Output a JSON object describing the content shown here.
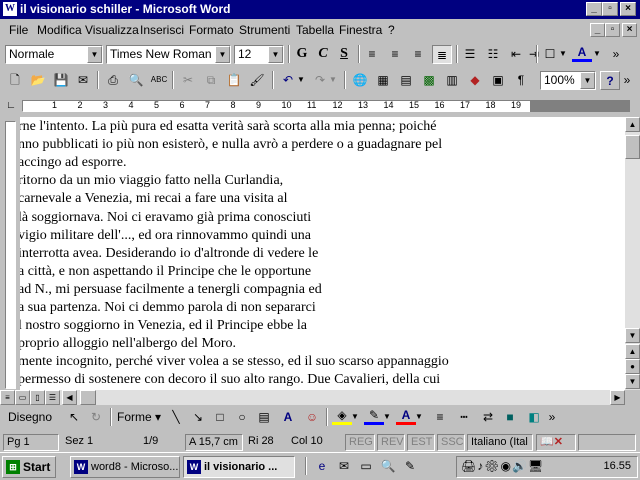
{
  "window": {
    "title": "il visionario schiller - Microsoft Word"
  },
  "menu": [
    "File",
    "Modifica",
    "Visualizza",
    "Inserisci",
    "Formato",
    "Strumenti",
    "Tabella",
    "Finestra",
    "?"
  ],
  "format_toolbar": {
    "style": "Normale",
    "font": "Times New Roman",
    "size": "12",
    "bold": "G",
    "italic": "C",
    "underline": "S"
  },
  "standard_toolbar": {
    "zoom": "100%"
  },
  "ruler": {
    "numbers": [
      "1",
      "2",
      "3",
      "4",
      "5",
      "6",
      "7",
      "8",
      "9",
      "10",
      "11",
      "12",
      "13",
      "14",
      "15",
      "16",
      "17",
      "18",
      "19"
    ]
  },
  "document": {
    "lines": [
      "rne l'intento. La più pura ed esatta verità sarà scorta alla mia penna; poiché",
      "nno pubblicati io più non esisterò, e nulla avrò a perdere o a guadagnare pel",
      "accingo ad esporre.",
      "ritorno  da  un  mio  viaggio  fatto  nella  Curlandia,",
      " carnevale a Venezia, mi recai a fare una visita al",
      "là soggiornava. Noi ci eravamo già prima conosciuti",
      "vigio militare dell'..., ed ora rinnovammo quindi una",
      "interrotta avea. Desiderando io d'altronde di vedere le",
      "a città, e non aspettando il Principe che le opportune",
      " ad N., mi persuase facilmente a tenergli compagnia ed",
      "a sua partenza. Noi ci demmo parola di non separarci",
      "l nostro soggiorno in Venezia, ed il Principe ebbe la",
      "proprio alloggio nell'albergo del Moro.",
      "mente incognito, perché viver volea a se stesso, ed il suo scarso appannaggio",
      " permesso di sostenere con decoro il suo alto rango. Due Cavalieri, della cui"
    ]
  },
  "drawing_toolbar": {
    "draw": "Disegno",
    "shapes": "Forme"
  },
  "status": {
    "page": "Pg 1",
    "section": "Sez 1",
    "pages": "1/9",
    "at": "A 15,7 cm",
    "line": "Ri 28",
    "col": "Col 10",
    "rec": "REG",
    "rev": "REV",
    "ext": "EST",
    "ovr": "SSC",
    "lang": "Italiano (Ital"
  },
  "taskbar": {
    "start": "Start",
    "task1": "word8 - Microso...",
    "task2": "il visionario ...",
    "clock": "16.55"
  }
}
